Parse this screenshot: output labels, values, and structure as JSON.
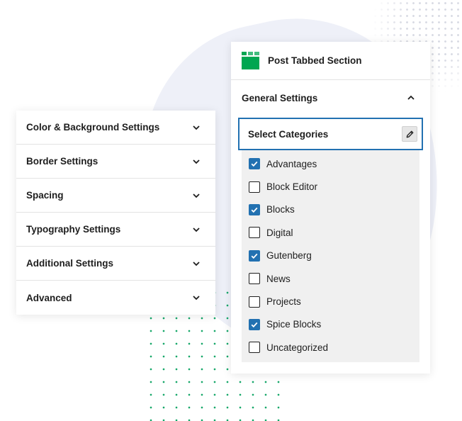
{
  "left_panel": {
    "items": [
      {
        "label": "Color & Background Settings"
      },
      {
        "label": "Border Settings"
      },
      {
        "label": "Spacing"
      },
      {
        "label": "Typography Settings"
      },
      {
        "label": "Additional Settings"
      },
      {
        "label": "Advanced"
      }
    ]
  },
  "right_panel": {
    "block_title": "Post Tabbed Section",
    "block_icon": "tabbed-section-icon",
    "section_title": "General Settings",
    "select_label": "Select Categories",
    "categories": [
      {
        "label": "Advantages",
        "checked": true
      },
      {
        "label": "Block Editor",
        "checked": false
      },
      {
        "label": "Blocks",
        "checked": true
      },
      {
        "label": "Digital",
        "checked": false
      },
      {
        "label": "Gutenberg",
        "checked": true
      },
      {
        "label": "News",
        "checked": false
      },
      {
        "label": "Projects",
        "checked": false
      },
      {
        "label": "Spice Blocks",
        "checked": true
      },
      {
        "label": "Uncategorized",
        "checked": false
      }
    ]
  },
  "colors": {
    "accent": "#2271b1",
    "brand_green": "#00a651",
    "list_bg": "#f0f0f0"
  }
}
